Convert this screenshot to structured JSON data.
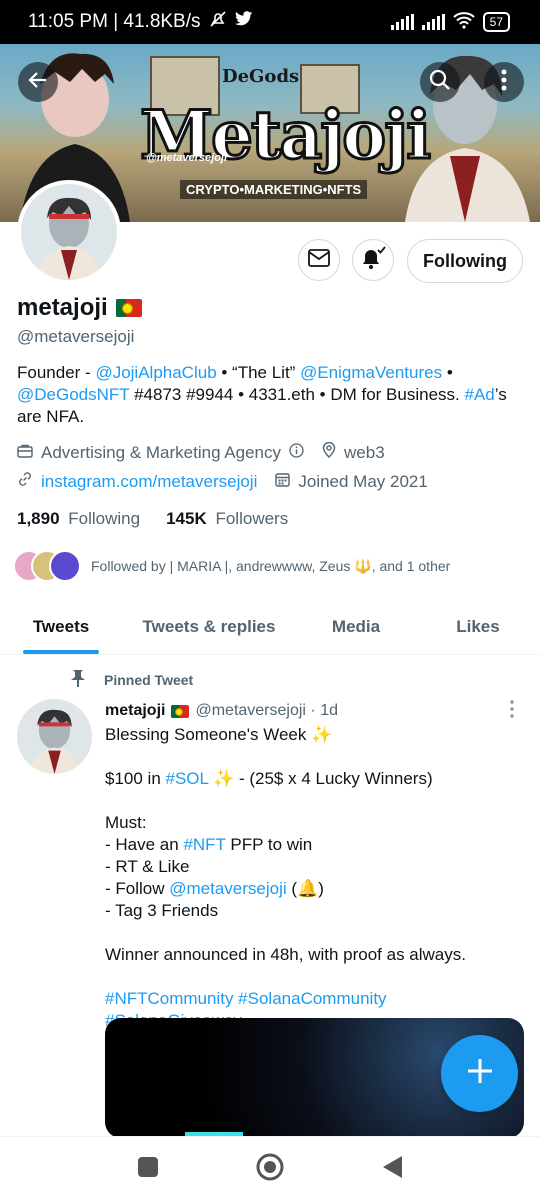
{
  "status_bar": {
    "time_speed": "11:05 PM | 41.8KB/s",
    "battery": "57"
  },
  "banner": {
    "title": "Metajoji",
    "handle_text": "@metaversejoji",
    "tagline": "CRYPTO•MARKETING•NFTS",
    "degods_text": "DeGods"
  },
  "profile": {
    "name": "metajoji",
    "handle": "@metaversejoji",
    "following_button": "Following",
    "bio": {
      "p1": "Founder - ",
      "l1": "@JojiAlphaClub",
      "p2": " • “The Lit” ",
      "l2": "@EnigmaVentures",
      "p3": " •",
      "l3": "@DeGodsNFT",
      "p4": " #4873 #9944 • 4331.eth • DM for Business. ",
      "l4": "#Ad",
      "p5": "’s are NFA."
    },
    "category": "Advertising & Marketing Agency",
    "location": "web3",
    "website": "instagram.com/metaversejoji",
    "joined": "Joined May 2021",
    "following_count": "1,890",
    "following_label": "Following",
    "followers_count": "145K",
    "followers_label": "Followers",
    "followed_by": "Followed by | MARIA |, andrewwww, Zeus 🔱, and 1 other"
  },
  "tabs": [
    "Tweets",
    "Tweets & replies",
    "Media",
    "Likes"
  ],
  "tweet": {
    "pinned_label": "Pinned Tweet",
    "author": "metajoji",
    "handle_time": "@metaversejoji · 1d",
    "line1": "Blessing Someone's Week ✨",
    "line2_pre": "$100 in ",
    "line2_tag": "#SOL",
    "line2_post": " ✨ - (25$ x 4 Lucky Winners)",
    "must": "Must:",
    "m1_pre": "- Have an ",
    "m1_tag": "#NFT",
    "m1_post": " PFP to win",
    "m2": "- RT & Like",
    "m3_pre": "- Follow ",
    "m3_tag": "@metaversejoji",
    "m3_post": " (🔔)",
    "m4": "- Tag 3 Friends",
    "winner": "Winner announced in 48h, with proof as always.",
    "hashtags": "#NFTCommunity #SolanaCommunity #SolanaGiveaway"
  },
  "colors": {
    "accent": "#1d9bf0",
    "text": "#0f1419",
    "muted": "#536471"
  },
  "icons": [
    "back-arrow-icon",
    "search-icon",
    "more-vertical-icon",
    "mail-icon",
    "bell-check-icon",
    "briefcase-icon",
    "info-icon",
    "location-icon",
    "link-icon",
    "calendar-icon",
    "pin-icon",
    "plus-icon",
    "square-icon",
    "circle-home-icon",
    "triangle-back-icon"
  ]
}
